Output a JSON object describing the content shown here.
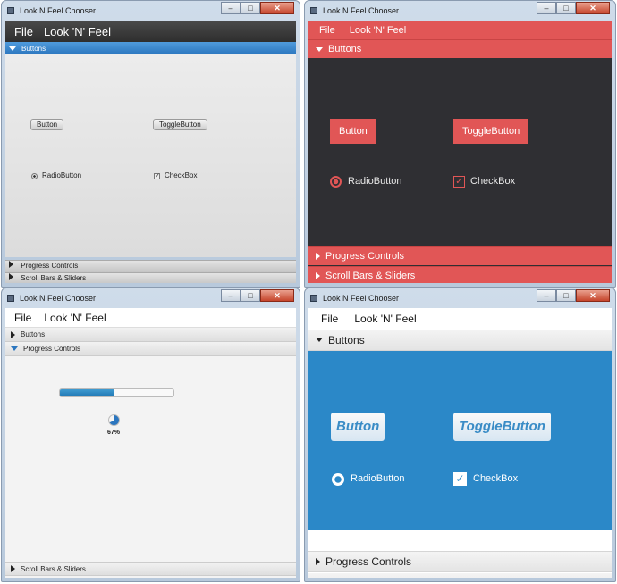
{
  "window_title": "Look N Feel Chooser",
  "caption_buttons": {
    "minimize": "–",
    "maximize": "□",
    "close": "✕"
  },
  "menu": {
    "file": "File",
    "lnf": "Look 'N' Feel"
  },
  "panes": {
    "buttons": "Buttons",
    "progress": "Progress Controls",
    "scroll": "Scroll Bars & Sliders"
  },
  "controls": {
    "button": "Button",
    "toggle_button": "ToggleButton",
    "radio_button": "RadioButton",
    "checkbox": "CheckBox",
    "checkbox_mark": "✓"
  },
  "progress": {
    "value": 0.48,
    "indicator_value": 0.67,
    "indicator_label": "67%"
  },
  "colors": {
    "modena_blue": "#2b76bf",
    "flat_red": "#e15656",
    "flat_dark": "#2f2f33",
    "flat_blue": "#2b88c8"
  }
}
